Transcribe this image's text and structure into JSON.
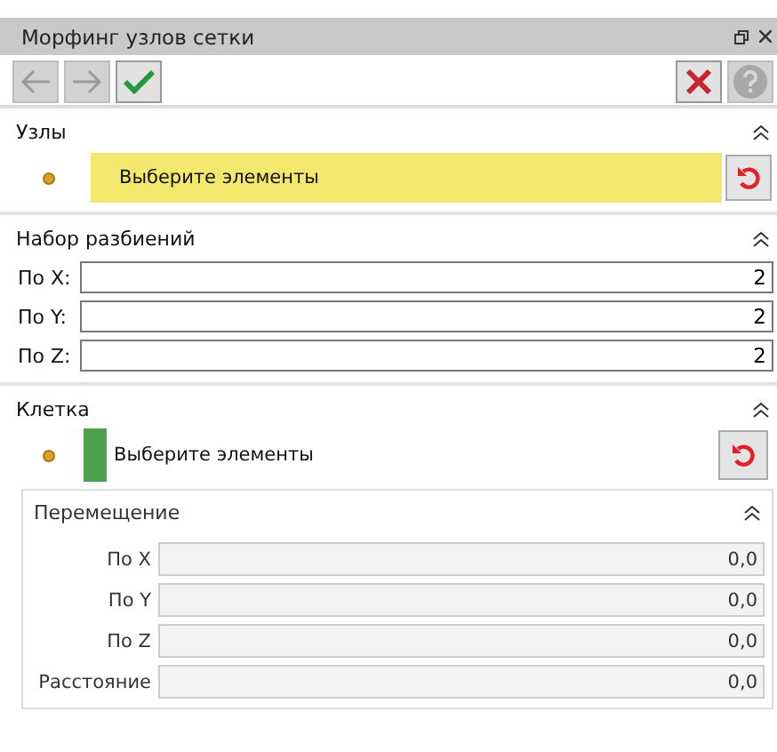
{
  "window": {
    "title": "Морфинг узлов сетки"
  },
  "toolbar": {
    "buttons": [
      {
        "kind": "back",
        "disabled": true
      },
      {
        "kind": "forward",
        "disabled": true
      },
      {
        "kind": "ok",
        "disabled": false
      }
    ],
    "right_buttons": [
      {
        "kind": "cancel",
        "disabled": false
      },
      {
        "kind": "help",
        "disabled": true
      }
    ]
  },
  "nodes": {
    "title": "Узлы",
    "expanded": true,
    "selector": {
      "text": "Выберите элементы",
      "active": true
    }
  },
  "divisions": {
    "title": "Набор разбиений",
    "expanded": true,
    "fields": [
      {
        "label": "По X:",
        "value": "2"
      },
      {
        "label": "По Y:",
        "value": "2"
      },
      {
        "label": "По Z:",
        "value": "2"
      }
    ]
  },
  "cell": {
    "title": "Клетка",
    "expanded": true,
    "selector": {
      "text": "Выберите элементы",
      "active": false,
      "color": "#4ea24e"
    },
    "movement": {
      "title": "Перемещение",
      "expanded": true,
      "fields": [
        {
          "label": "По X",
          "value": "0,0",
          "disabled": true
        },
        {
          "label": "По Y",
          "value": "0,0",
          "disabled": true
        },
        {
          "label": "По Z",
          "value": "0,0",
          "disabled": true
        },
        {
          "label": "Расстояние",
          "value": "0,0",
          "disabled": true
        }
      ]
    }
  }
}
